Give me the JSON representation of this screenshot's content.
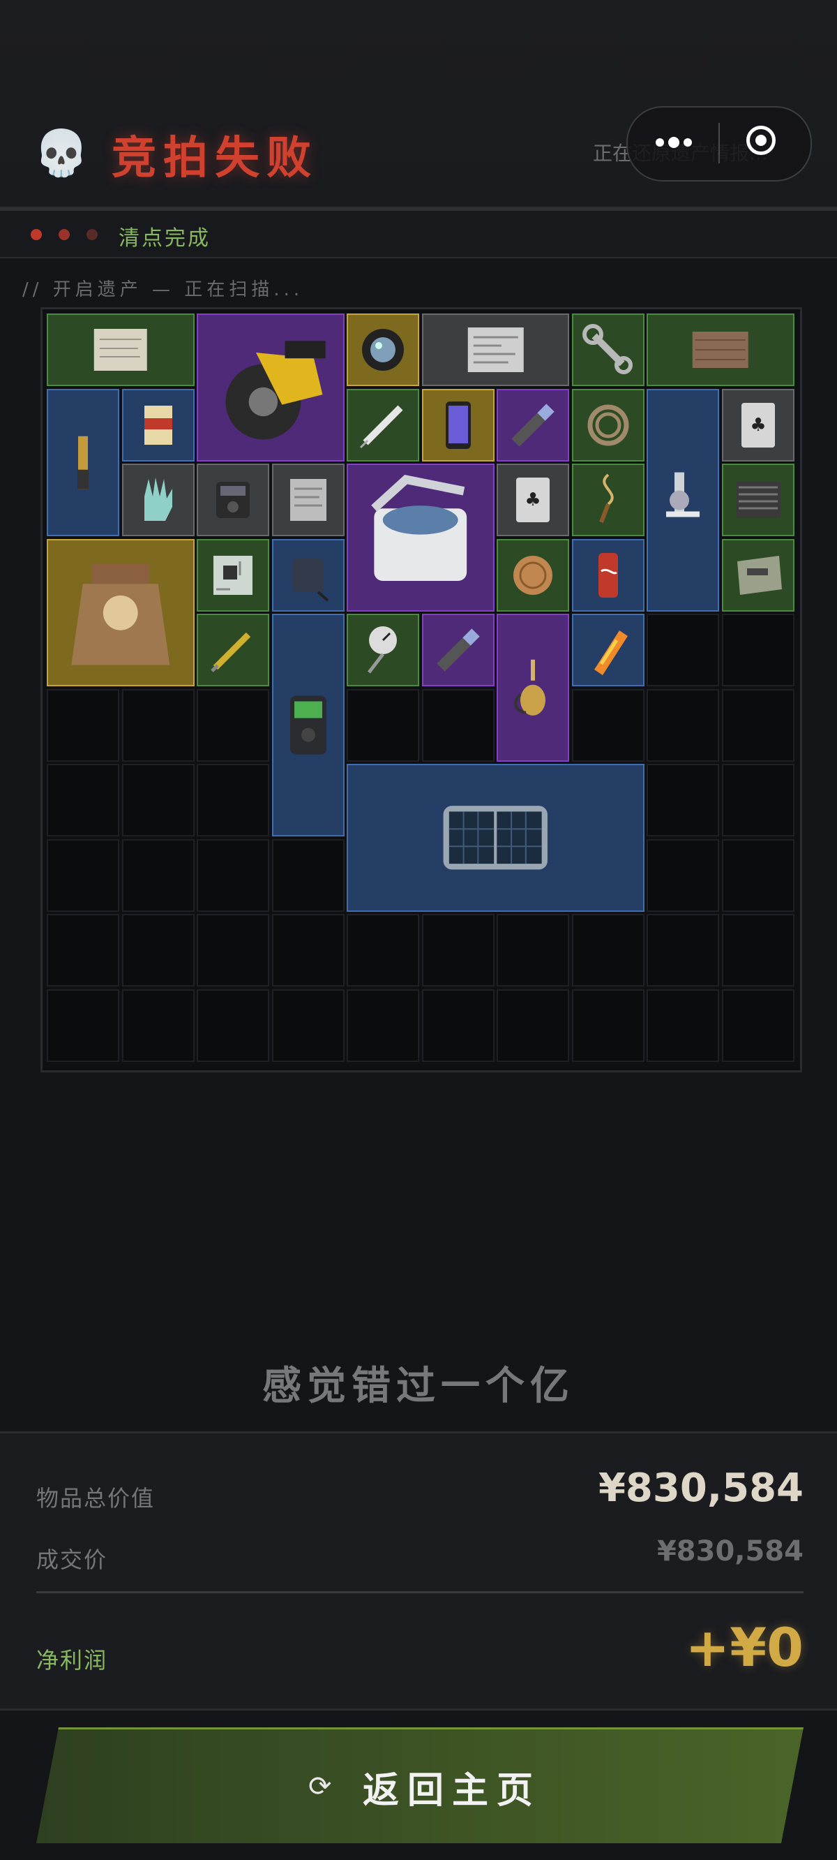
{
  "header": {
    "title": "竞拍失败",
    "restore_text": "正在还原遗产情报...",
    "status_label": "清点完成",
    "scan_text": "// 开启遗产 — 正在扫描..."
  },
  "colors": {
    "title_red": "#d0422f",
    "status_green": "#88b960",
    "profit_gold": "#d2aa45",
    "rarity_green": "#2c4b25",
    "rarity_blue": "#243e66",
    "rarity_purple": "#4f2a78",
    "rarity_gold": "#7d6a1e",
    "rarity_gray": "#3c3e3f"
  },
  "inventory": {
    "columns": 10,
    "rows": 10,
    "items": [
      {
        "name": "old-paper",
        "rarity": "green",
        "col": 0,
        "row": 0,
        "w": 2,
        "h": 1
      },
      {
        "name": "circular-saw",
        "rarity": "purple",
        "col": 2,
        "row": 0,
        "w": 2,
        "h": 2
      },
      {
        "name": "camera-lens",
        "rarity": "gold",
        "col": 4,
        "row": 0,
        "w": 1,
        "h": 1
      },
      {
        "name": "newspaper",
        "rarity": "gray",
        "col": 5,
        "row": 0,
        "w": 2,
        "h": 1
      },
      {
        "name": "wrench",
        "rarity": "green",
        "col": 7,
        "row": 0,
        "w": 1,
        "h": 1
      },
      {
        "name": "wood-plank",
        "rarity": "green",
        "col": 8,
        "row": 0,
        "w": 2,
        "h": 1
      },
      {
        "name": "spyglass",
        "rarity": "blue",
        "col": 0,
        "row": 1,
        "w": 1,
        "h": 2
      },
      {
        "name": "memory-card",
        "rarity": "blue",
        "col": 1,
        "row": 1,
        "w": 1,
        "h": 1
      },
      {
        "name": "syringe",
        "rarity": "green",
        "col": 4,
        "row": 1,
        "w": 1,
        "h": 1
      },
      {
        "name": "smartphone",
        "rarity": "gold",
        "col": 5,
        "row": 1,
        "w": 1,
        "h": 1
      },
      {
        "name": "flashlight",
        "rarity": "purple",
        "col": 6,
        "row": 1,
        "w": 1,
        "h": 1
      },
      {
        "name": "hose",
        "rarity": "green",
        "col": 7,
        "row": 1,
        "w": 1,
        "h": 1
      },
      {
        "name": "microscope",
        "rarity": "blue",
        "col": 8,
        "row": 1,
        "w": 1,
        "h": 3
      },
      {
        "name": "playing-card",
        "rarity": "gray",
        "col": 9,
        "row": 1,
        "w": 1,
        "h": 1
      },
      {
        "name": "rubber-glove",
        "rarity": "gray",
        "col": 1,
        "row": 2,
        "w": 1,
        "h": 1
      },
      {
        "name": "multimeter",
        "rarity": "gray",
        "col": 2,
        "row": 2,
        "w": 1,
        "h": 1
      },
      {
        "name": "document",
        "rarity": "gray",
        "col": 3,
        "row": 2,
        "w": 1,
        "h": 1
      },
      {
        "name": "centrifuge",
        "rarity": "purple",
        "col": 4,
        "row": 2,
        "w": 2,
        "h": 2
      },
      {
        "name": "playing-card",
        "rarity": "gray",
        "col": 6,
        "row": 2,
        "w": 1,
        "h": 1
      },
      {
        "name": "pendulum-charm",
        "rarity": "green",
        "col": 7,
        "row": 2,
        "w": 1,
        "h": 1
      },
      {
        "name": "cpu-cooler",
        "rarity": "green",
        "col": 9,
        "row": 2,
        "w": 1,
        "h": 1
      },
      {
        "name": "antique-clock",
        "rarity": "gold",
        "col": 0,
        "row": 3,
        "w": 2,
        "h": 2
      },
      {
        "name": "circuit-board",
        "rarity": "green",
        "col": 2,
        "row": 3,
        "w": 1,
        "h": 1
      },
      {
        "name": "power-bank",
        "rarity": "blue",
        "col": 3,
        "row": 3,
        "w": 1,
        "h": 1
      },
      {
        "name": "bronze-coin",
        "rarity": "green",
        "col": 6,
        "row": 3,
        "w": 1,
        "h": 1
      },
      {
        "name": "soda-can",
        "rarity": "blue",
        "col": 7,
        "row": 3,
        "w": 1,
        "h": 1
      },
      {
        "name": "food-pouch",
        "rarity": "green",
        "col": 9,
        "row": 3,
        "w": 1,
        "h": 1
      },
      {
        "name": "screwdriver",
        "rarity": "green",
        "col": 2,
        "row": 4,
        "w": 1,
        "h": 1
      },
      {
        "name": "voice-recorder",
        "rarity": "blue",
        "col": 3,
        "row": 4,
        "w": 1,
        "h": 3
      },
      {
        "name": "pressure-gauge",
        "rarity": "green",
        "col": 4,
        "row": 4,
        "w": 1,
        "h": 1
      },
      {
        "name": "flashlight",
        "rarity": "purple",
        "col": 5,
        "row": 4,
        "w": 1,
        "h": 1
      },
      {
        "name": "hookah",
        "rarity": "purple",
        "col": 6,
        "row": 4,
        "w": 1,
        "h": 2
      },
      {
        "name": "chip-tube",
        "rarity": "blue",
        "col": 7,
        "row": 4,
        "w": 1,
        "h": 1
      },
      {
        "name": "solar-panel",
        "rarity": "blue",
        "col": 4,
        "row": 6,
        "w": 4,
        "h": 2
      }
    ]
  },
  "slogan": "感觉错过一个亿",
  "summary": {
    "total_label": "物品总价值",
    "total_value": "¥830,584",
    "deal_label": "成交价",
    "deal_value": "¥830,584",
    "profit_label": "净利润",
    "profit_value": "+¥0"
  },
  "button": {
    "icon": "refresh-icon",
    "label": "返回主页"
  }
}
